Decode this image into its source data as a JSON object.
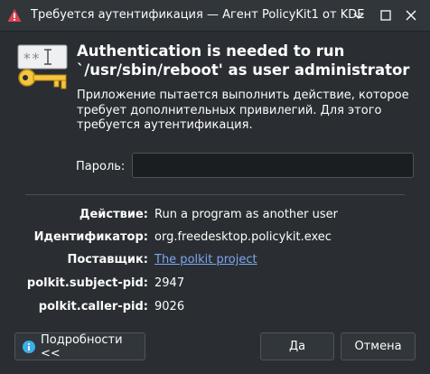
{
  "window": {
    "title": "Требуется аутентификация — Агент PolicyKit1 от KDE",
    "controls": [
      "chevron-down-icon",
      "maximize-icon",
      "close-icon"
    ]
  },
  "main": {
    "heading": "Authentication is needed to run `/usr/sbin/reboot' as user administrator",
    "description": "Приложение пытается выполнить действие, которое требует дополнительных привилегий. Для этого требуется аутентификация."
  },
  "password": {
    "label": "Пароль:",
    "value": "",
    "placeholder": ""
  },
  "details": [
    {
      "label": "Действие:",
      "value": "Run a program as another user"
    },
    {
      "label": "Идентификатор:",
      "value": "org.freedesktop.policykit.exec"
    },
    {
      "label": "Поставщик:",
      "value": "The polkit project",
      "is_link": true
    },
    {
      "label": "polkit.subject-pid:",
      "value": "2947"
    },
    {
      "label": "polkit.caller-pid:",
      "value": "9026"
    }
  ],
  "buttons": {
    "details": "Подробности <<",
    "ok": "Да",
    "cancel": "Отмена"
  },
  "colors": {
    "background": "#2a2e32",
    "titlebar": "#31363b",
    "text": "#fcfcfc",
    "link": "#7da6f0",
    "accent": "#3daee9"
  }
}
